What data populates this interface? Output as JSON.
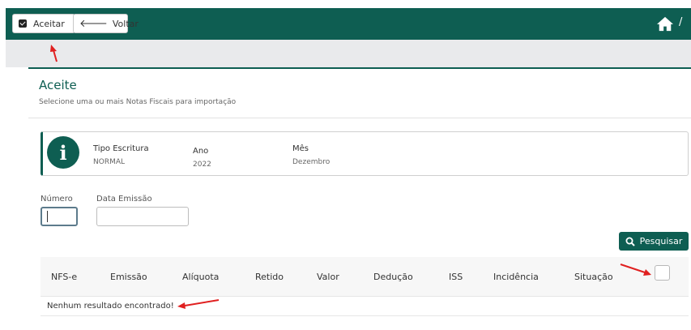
{
  "toolbar": {
    "aceitar_label": "Aceitar",
    "voltar_label": "Voltar",
    "breadcrumb_sep": "/"
  },
  "page": {
    "title": "Aceite",
    "subtitle": "Selecione uma ou mais Notas Fiscais para importação"
  },
  "info": {
    "icon_glyph": "i",
    "fields": [
      {
        "label": "Tipo Escritura",
        "value": "NORMAL"
      },
      {
        "label": "Ano",
        "value": "2022"
      },
      {
        "label": "Mês",
        "value": "Dezembro"
      }
    ]
  },
  "filters": {
    "numero_label": "Número",
    "numero_value": "",
    "data_label": "Data Emissão",
    "data_value": ""
  },
  "search_label": "Pesquisar",
  "table": {
    "columns": [
      "NFS-e",
      "Emissão",
      "Alíquota",
      "Retido",
      "Valor",
      "Dedução",
      "ISS",
      "Incidência",
      "Situação"
    ],
    "empty_message": "Nenhum resultado encontrado!"
  },
  "colors": {
    "brand": "#0e5e52",
    "annotation": "#e02020"
  }
}
